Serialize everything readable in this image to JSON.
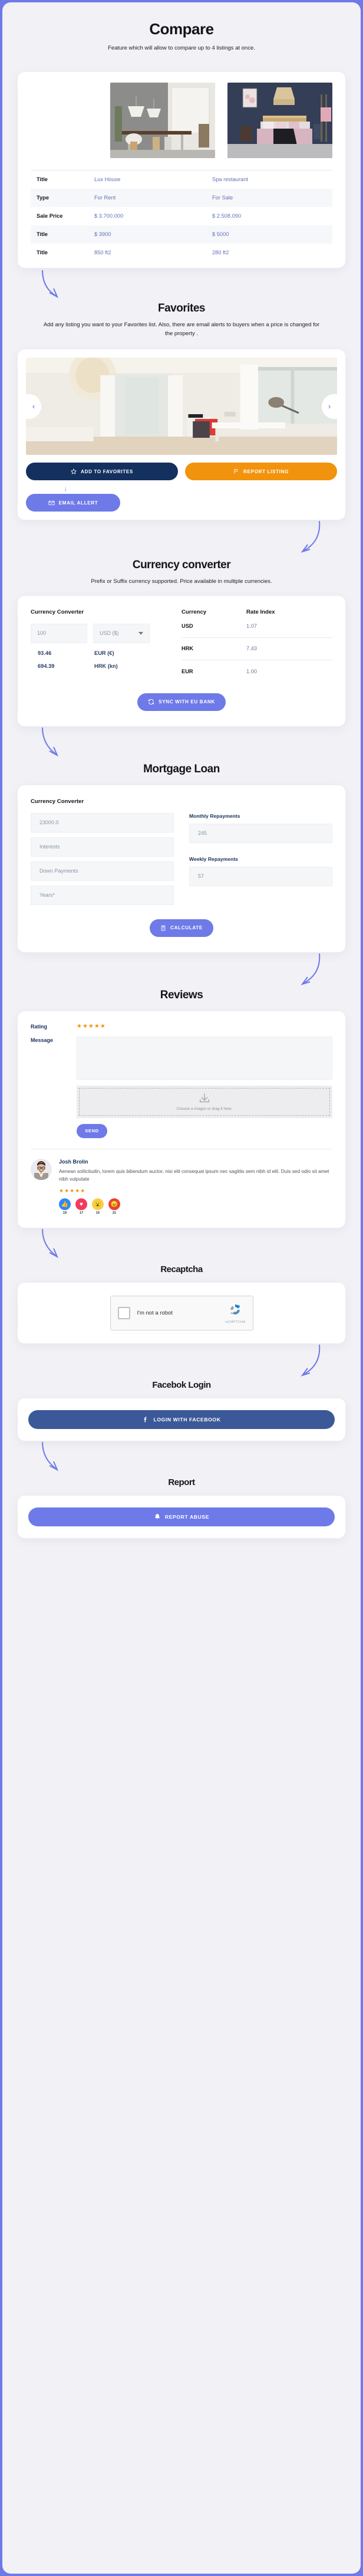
{
  "compare": {
    "title": "Compare",
    "subtitle": "Feature which will allow to compare up to 4 listings at once.",
    "rows": [
      {
        "label": "Title",
        "a": "Lux House",
        "b": "Spa restaurant"
      },
      {
        "label": "Type",
        "a": "For Rent",
        "b": "For Sale"
      },
      {
        "label": "Sale Price",
        "a": "$ 3.700.000",
        "b": "$ 2.508.090"
      },
      {
        "label": "Title",
        "a": "$ 3900",
        "b": "$ 5000"
      },
      {
        "label": "Title",
        "a": "850 ft2",
        "b": "280 ft2"
      }
    ]
  },
  "favorites": {
    "title": "Favorites",
    "subtitle": "Add any listing you want to your Favorites list. Also, there are email alerts to buyers when a price is changed for the property .",
    "prev_icon": "chevron-left-icon",
    "next_icon": "chevron-right-icon",
    "add_label": "ADD TO FAVORITES",
    "report_label": "REPORT LISTING",
    "email_label": "EMAIL ALLERT",
    "colors": {
      "navy": "#13305f",
      "orange": "#f2930d",
      "indigo": "#6e7ae8"
    }
  },
  "currency": {
    "title": "Currency converter",
    "subtitle": "Prefix or Suffix currency supported. Price available in multiple currencies.",
    "card_heading": "Currency Converter",
    "amount_placeholder": "100",
    "selected_currency": "USD ($)",
    "conversions": [
      {
        "value": "93.46",
        "currency": "EUR (€)"
      },
      {
        "value": "694.39",
        "currency": "HRK (kn)"
      }
    ],
    "table_headers": {
      "currency": "Currency",
      "rate": "Rate Index"
    },
    "rates": [
      {
        "currency": "USD",
        "rate": "1.07"
      },
      {
        "currency": "HRK",
        "rate": "7.43"
      },
      {
        "currency": "EUR",
        "rate": "1.00"
      }
    ],
    "sync_label": "SYNC WITH EU BANK"
  },
  "mortgage": {
    "title": "Mortgage Loan",
    "card_heading": "Currency Converter",
    "fields": [
      {
        "placeholder": "23000.0"
      },
      {
        "placeholder": "Interests"
      },
      {
        "placeholder": "Down Payments"
      },
      {
        "placeholder": "Years*"
      }
    ],
    "monthly_label": "Monthly Repayments",
    "monthly_value": "245",
    "weekly_label": "Weekly Repayments",
    "weekly_value": "57",
    "calculate_label": "CALCULATE"
  },
  "reviews": {
    "title": "Reviews",
    "rating_label": "Rating",
    "rating_stars": "★★★★★",
    "message_label": "Message",
    "message_value": "",
    "dropzone_text": "Choose a images or drag it here.",
    "send_label": "SEND",
    "reviewer": {
      "name": "Josh Brolin",
      "text": "Aenean sollicitudin, lorem quis bibendum auctor, nisi elit consequat ipsum nec sagittis sem nibh id elit. Duis sed odio sit amet nibh vulputate",
      "stars": "★★★★★",
      "reactions": [
        {
          "icon": "thumbs-up-icon",
          "glyph": "👍",
          "count": "19",
          "color": "#2d88ff"
        },
        {
          "icon": "heart-icon",
          "glyph": "♥",
          "count": "17",
          "color": "#f23b5c"
        },
        {
          "icon": "wow-face-icon",
          "glyph": "😮",
          "count": "15",
          "color": "#f7d04b"
        },
        {
          "icon": "angry-face-icon",
          "glyph": "😠",
          "count": "21",
          "color": "#e94235"
        }
      ]
    }
  },
  "recaptcha": {
    "title": "Recaptcha",
    "checkbox_label": "I'm not a robot",
    "brand": "reCAPTCHA"
  },
  "facebook": {
    "title": "Facebok Login",
    "button_label": "LOGIN WITH FACEBOOK",
    "color": "#3b5998"
  },
  "report": {
    "title": "Report",
    "button_label": "REPORT ABUSE",
    "color": "#6e7ae8"
  }
}
